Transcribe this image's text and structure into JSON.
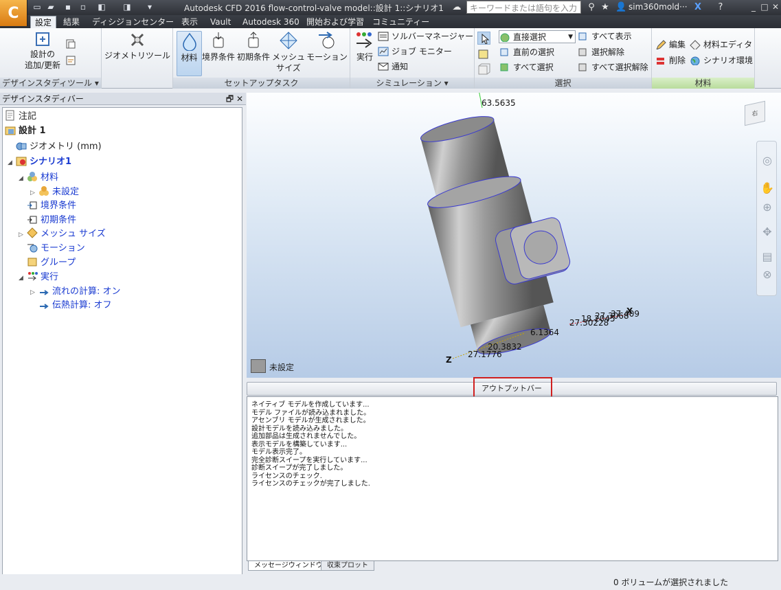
{
  "titlebar": {
    "app_icon": "C",
    "title": "Autodesk CFD 2016   flow-control-valve model::設計 1::シナリオ1",
    "search_placeholder": "キーワードまたは語句を入力",
    "user": "sim360mold···",
    "icons": [
      "new-icon",
      "open-icon",
      "save-icon",
      "save-as-icon",
      "binoculars-icon",
      "star-icon",
      "user-icon",
      "x-exchange-icon",
      "help-icon"
    ],
    "window_buttons": [
      "_",
      "□",
      "✕"
    ]
  },
  "ribbon_tabs": [
    "設定",
    "結果",
    "ディシジョンセンター",
    "表示",
    "Vault",
    "Autodesk 360",
    "開始および学習",
    "コミュニティー"
  ],
  "ribbon": {
    "design_study": {
      "add_update_line1": "設計の",
      "add_update_line2": "追加/更新",
      "title": "デザインスタディツール ▾"
    },
    "geometry_tools": "ジオメトリツール",
    "setup": {
      "material": "材料",
      "boundary": "境界条件",
      "initial": "初期条件",
      "mesh_line1": "メッシュ",
      "mesh_line2": "サイズ",
      "motion": "モーション",
      "title": "セットアップタスク"
    },
    "simulation": {
      "run": "実行",
      "solver_manager": "ソルバーマネージャー",
      "job_monitor": "ジョブ モニター",
      "notify": "通知",
      "title": "シミュレーション ▾"
    },
    "selection": {
      "direct": "直接選択",
      "previous": "直前の選択",
      "select_all": "すべて選択",
      "show_all": "すべて表示",
      "deselect": "選択解除",
      "deselect_all": "すべて選択解除",
      "title": "選択"
    },
    "materials": {
      "edit": "編集",
      "editor": "材料エディタ",
      "delete": "削除",
      "scenario_env": "シナリオ環境",
      "title": "材料"
    }
  },
  "design_study_bar": {
    "title": "デザインスタディバー",
    "controls": "🗗 ✕",
    "tree": {
      "notes": "注記",
      "design": "設計 1",
      "geometry": "ジオメトリ (mm)",
      "scenario": "シナリオ1",
      "materials": "材料",
      "unset": "未設定",
      "boundary": "境界条件",
      "initial": "初期条件",
      "mesh": "メッシュ サイズ",
      "motion": "モーション",
      "group": "グループ",
      "run": "実行",
      "flow_calc": "流れの計算: オン",
      "heat_calc": "伝熱計算: オフ"
    }
  },
  "viewport": {
    "dims": [
      "63.5635",
      "18.2045",
      "27.3068",
      "37.409",
      "6.1364",
      "27.30228",
      "20.3832",
      "27.1776"
    ],
    "axis_x": "X",
    "axis_z": "Z",
    "legend_label": "未設定",
    "viewcube_label": "右"
  },
  "output": {
    "bar_label": "アウトプットバー",
    "lines": [
      "ネイティブ モデルを作成しています...",
      "モデル ファイルが読み込まれました。",
      "アセンブリ モデルが生成されました。",
      "設計モデルを読み込みました。",
      "追加部品は生成されませんでした。",
      "表示モデルを構築しています...",
      "モデル表示完了。",
      "完全診断スイープを実行しています...",
      "診断スイープが完了しました。",
      "ライセンスのチェック.",
      "ライセンスのチェックが完了しました."
    ],
    "tabs": [
      "メッセージウィンドウ",
      "収束プロット"
    ]
  },
  "status": "0 ボリュームが選択されました",
  "colors": {
    "accent": "#1a3bd1",
    "highlight": "#d01f1f",
    "ribbon_tab_bg": "#2c2f35",
    "model_grey": "#8e8e8e"
  }
}
